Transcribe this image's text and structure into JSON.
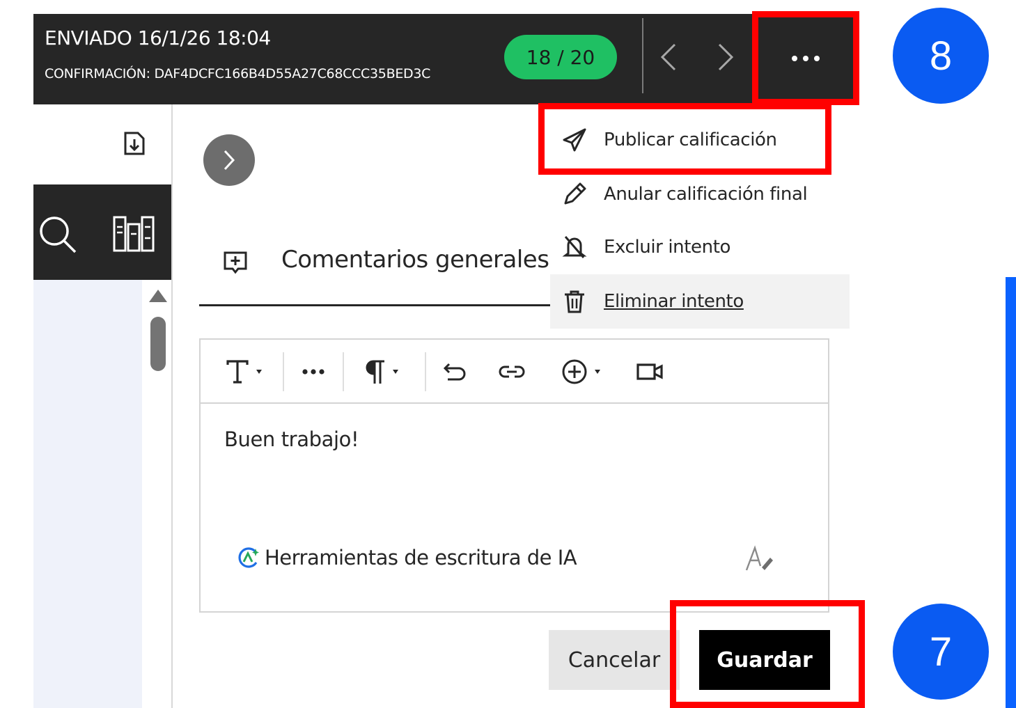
{
  "header": {
    "submission_status": "ENVIADO 16/1/26 18:04",
    "confirmation": "CONFIRMACIÓN: DAF4DCFC166B4D55A27C68CCC35BED3C",
    "grade": "18 / 20"
  },
  "actions_menu": {
    "items": [
      {
        "label": "Publicar calificación",
        "icon": "send-icon"
      },
      {
        "label": "Anular calificación final",
        "icon": "pencil-icon"
      },
      {
        "label": "Excluir intento",
        "icon": "bell-off-icon"
      },
      {
        "label": "Eliminar intento",
        "icon": "trash-icon"
      }
    ]
  },
  "feedback": {
    "title": "Comentarios generales",
    "body_text": "Buen trabajo!",
    "ai_tools_label": "Herramientas de escritura de IA"
  },
  "buttons": {
    "cancel": "Cancelar",
    "save": "Guardar"
  },
  "annotations": {
    "step_save": "7",
    "step_publish": "8",
    "highlight_color": "#ff0000",
    "badge_color": "#0a5bf2"
  },
  "colors": {
    "grade_pill": "#1fc063",
    "header_bg": "#262626",
    "save_button": "#000000",
    "doc_pane": "#eff2fa"
  }
}
